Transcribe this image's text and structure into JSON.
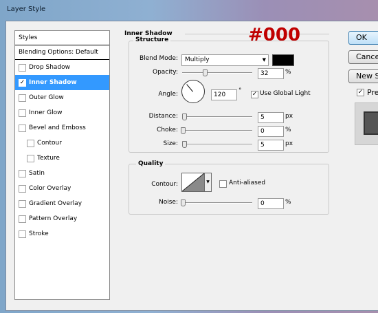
{
  "window": {
    "title": "Layer Style"
  },
  "styles_list": {
    "header": "Styles",
    "blending": "Blending Options: Default",
    "items": [
      {
        "label": "Drop Shadow",
        "checked": false,
        "selected": false,
        "sub": false
      },
      {
        "label": "Inner Shadow",
        "checked": true,
        "selected": true,
        "sub": false
      },
      {
        "label": "Outer Glow",
        "checked": false,
        "selected": false,
        "sub": false
      },
      {
        "label": "Inner Glow",
        "checked": false,
        "selected": false,
        "sub": false
      },
      {
        "label": "Bevel and Emboss",
        "checked": false,
        "selected": false,
        "sub": false
      },
      {
        "label": "Contour",
        "checked": false,
        "selected": false,
        "sub": true
      },
      {
        "label": "Texture",
        "checked": false,
        "selected": false,
        "sub": true
      },
      {
        "label": "Satin",
        "checked": false,
        "selected": false,
        "sub": false
      },
      {
        "label": "Color Overlay",
        "checked": false,
        "selected": false,
        "sub": false
      },
      {
        "label": "Gradient Overlay",
        "checked": false,
        "selected": false,
        "sub": false
      },
      {
        "label": "Pattern Overlay",
        "checked": false,
        "selected": false,
        "sub": false
      },
      {
        "label": "Stroke",
        "checked": false,
        "selected": false,
        "sub": false
      }
    ]
  },
  "inner_shadow": {
    "title": "Inner Shadow",
    "annotation": "#000",
    "structure": {
      "title": "Structure",
      "blend_mode_label": "Blend Mode:",
      "blend_mode_value": "Multiply",
      "color": "#000000",
      "opacity_label": "Opacity:",
      "opacity_value": "32",
      "opacity_unit": "%",
      "angle_label": "Angle:",
      "angle_value": "120",
      "angle_unit": "°",
      "global_light_label": "Use Global Light",
      "global_light_checked": true,
      "distance_label": "Distance:",
      "distance_value": "5",
      "distance_unit": "px",
      "choke_label": "Choke:",
      "choke_value": "0",
      "choke_unit": "%",
      "size_label": "Size:",
      "size_value": "5",
      "size_unit": "px"
    },
    "quality": {
      "title": "Quality",
      "contour_label": "Contour:",
      "antialiased_label": "Anti-aliased",
      "antialiased_checked": false,
      "noise_label": "Noise:",
      "noise_value": "0",
      "noise_unit": "%"
    }
  },
  "buttons": {
    "ok": "OK",
    "cancel": "Cancel",
    "new_style": "New Style...",
    "preview_label": "Preview",
    "preview_checked": true
  }
}
